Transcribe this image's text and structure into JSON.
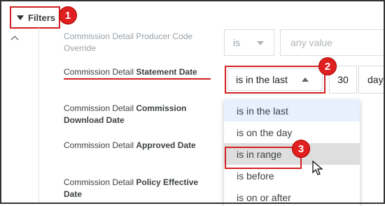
{
  "filters": {
    "label": "Filters",
    "tail": "("
  },
  "rows": [
    {
      "label_prefix": "Commission Detail",
      "label_bold": "Producer Code",
      "label_line2": "Override",
      "faded": true
    },
    {
      "label_prefix": "Commission Detail",
      "label_bold": "Statement Date",
      "label_line2": ""
    },
    {
      "label_prefix": "Commission Detail",
      "label_bold": "Commission",
      "label_line2": "Download Date"
    },
    {
      "label_prefix": "Commission Detail",
      "label_bold": "Approved Date",
      "label_line2": ""
    },
    {
      "label_prefix": "Commission Detail",
      "label_bold": "Policy Effective",
      "label_line2": "Date"
    }
  ],
  "controls": {
    "operator_is": "is",
    "any_value_placeholder": "any value",
    "statement_operator": "is in the last",
    "statement_number": "30",
    "statement_unit": "day"
  },
  "dropdown": {
    "options": [
      "is in the last",
      "is on the day",
      "is in range",
      "is before",
      "is on or after"
    ],
    "selected": "is in the last",
    "hovered": "is in range"
  },
  "badges": [
    "1",
    "2",
    "3"
  ],
  "colors": {
    "annotation_red": "#d31f1f",
    "selected_bg": "#e8f0fe",
    "hover_bg": "#dedede"
  }
}
